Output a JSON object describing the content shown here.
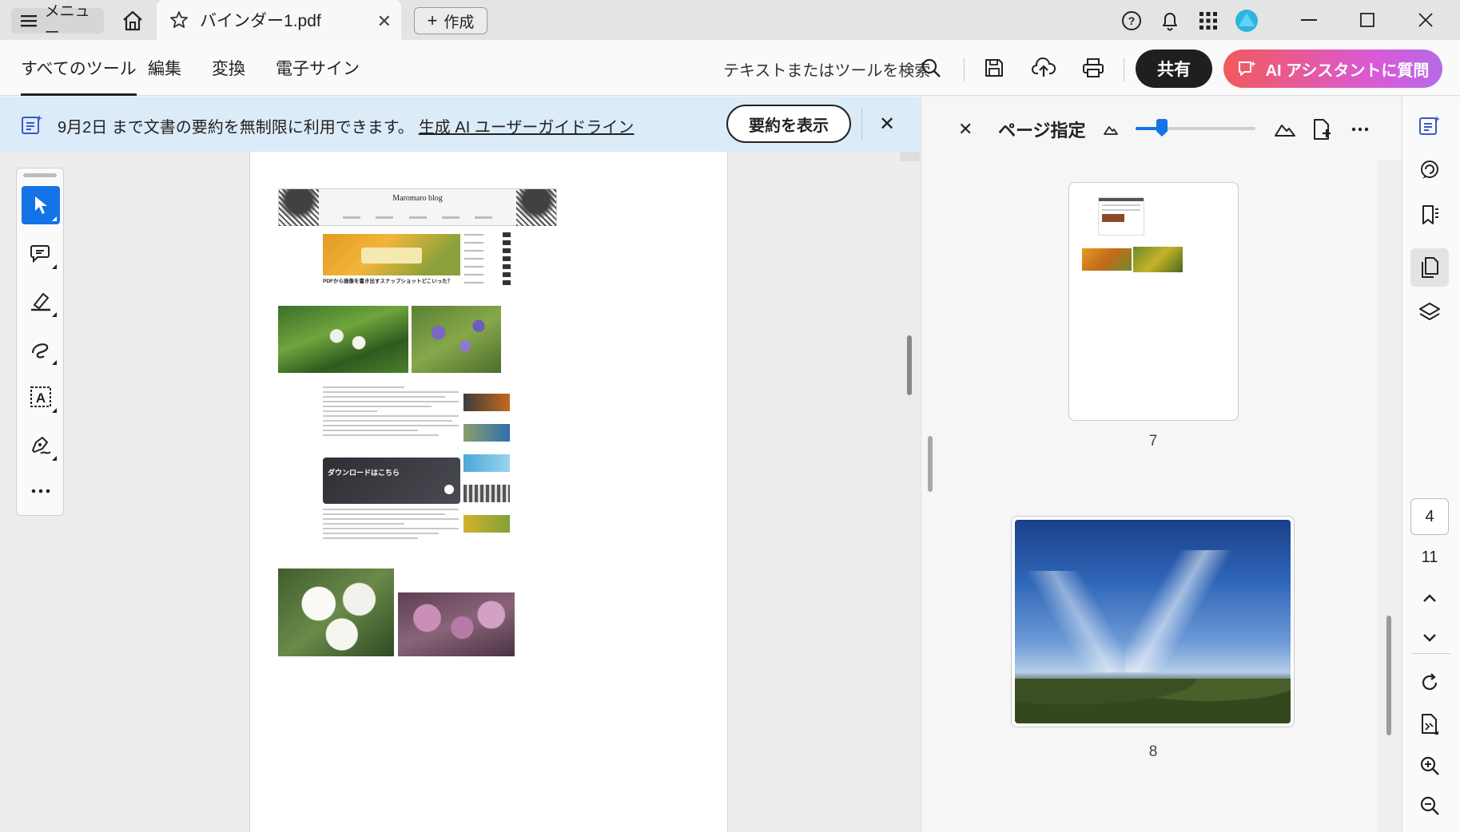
{
  "titlebar": {
    "menu_label": "メニュー",
    "tab_title": "バインダー1.pdf",
    "create_label": "作成"
  },
  "toolbar": {
    "tabs": [
      {
        "label": "すべてのツール"
      },
      {
        "label": "編集"
      },
      {
        "label": "変換"
      },
      {
        "label": "電子サイン"
      }
    ],
    "search_placeholder": "テキストまたはツールを検索",
    "share_label": "共有",
    "ai_label": "AI アシスタントに質問"
  },
  "banner": {
    "message": "9月2日 まで文書の要約を無制限に利用できます。",
    "link": "生成 AI ユーザーガイドライン",
    "summary_button": "要約を表示"
  },
  "blog_page": {
    "blog_title": "Maromaro blog",
    "post_title": "PDFから画像を書き出すスナップショットどこいった？",
    "download_title": "ダウンロードはこちら"
  },
  "page_panel": {
    "title": "ページ指定",
    "zoom_fraction": 0.22,
    "thumbnails": [
      {
        "label": "7"
      },
      {
        "label": "8"
      }
    ]
  },
  "rail": {
    "current_page": "4",
    "total_pages": "11"
  },
  "colors": {
    "accent": "#1473e6",
    "banner_bg": "#dcebf8",
    "share_bg": "#1f1f1f"
  }
}
